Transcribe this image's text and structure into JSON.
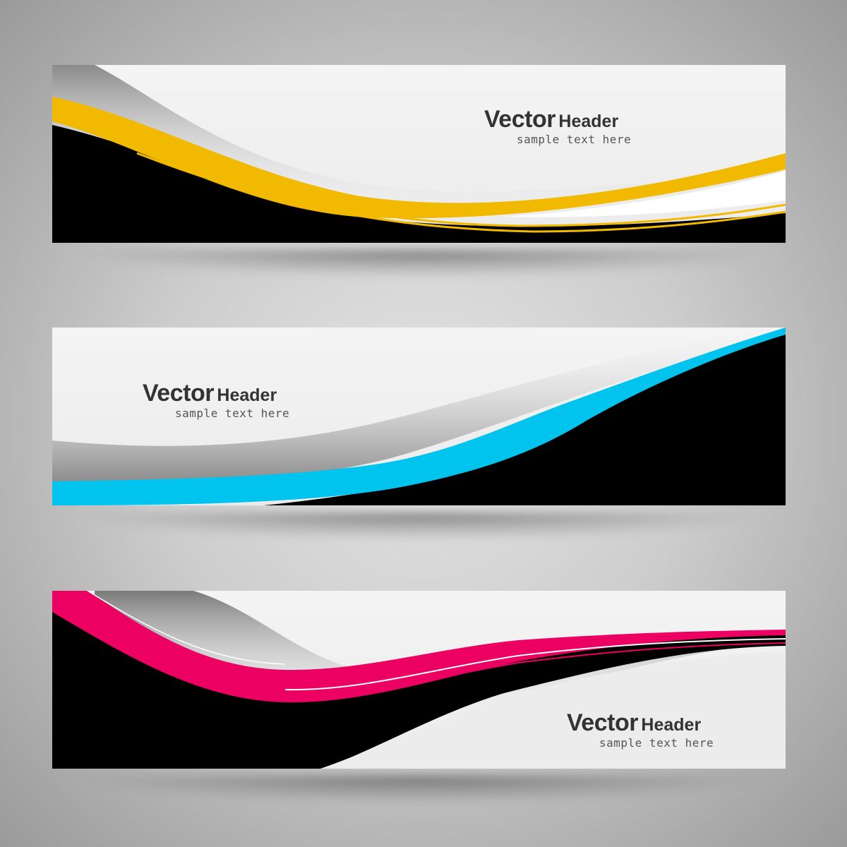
{
  "banners": [
    {
      "title_word1": "Vector",
      "title_word2": "Header",
      "subtitle": "sample text here",
      "accent_color": "#f1b900",
      "dark_color": "#000000"
    },
    {
      "title_word1": "Vector",
      "title_word2": "Header",
      "subtitle": "sample text here",
      "accent_color": "#00c4ee",
      "dark_color": "#000000"
    },
    {
      "title_word1": "Vector",
      "title_word2": "Header",
      "subtitle": "sample text here",
      "accent_color": "#ec0062",
      "dark_color": "#000000"
    }
  ]
}
